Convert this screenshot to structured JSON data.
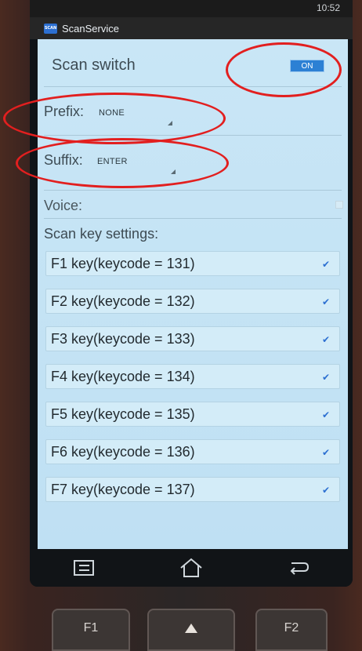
{
  "status": {
    "time": "10:52"
  },
  "app": {
    "title": "ScanService",
    "icon_text": "SCAN"
  },
  "scan_switch": {
    "label": "Scan switch",
    "state": "ON"
  },
  "prefix": {
    "label": "Prefix:",
    "value": "NONE"
  },
  "suffix": {
    "label": "Suffix:",
    "value": "ENTER"
  },
  "voice": {
    "label": "Voice:",
    "checked": false
  },
  "scan_keys": {
    "label": "Scan key settings:",
    "items": [
      {
        "label": "F1 key(keycode = 131)",
        "checked": true
      },
      {
        "label": "F2 key(keycode = 132)",
        "checked": true
      },
      {
        "label": "F3 key(keycode = 133)",
        "checked": true
      },
      {
        "label": "F4 key(keycode = 134)",
        "checked": true
      },
      {
        "label": "F5 key(keycode = 135)",
        "checked": true
      },
      {
        "label": "F6 key(keycode = 136)",
        "checked": true
      },
      {
        "label": "F7 key(keycode = 137)",
        "checked": true
      }
    ]
  },
  "navbar": {
    "icons": [
      "recent-apps-icon",
      "home-icon",
      "back-icon"
    ]
  },
  "hardware_keys": {
    "f1": "F1",
    "f2": "F2"
  },
  "colors": {
    "highlight": "#e21f1f",
    "accent": "#2c6fd1"
  }
}
